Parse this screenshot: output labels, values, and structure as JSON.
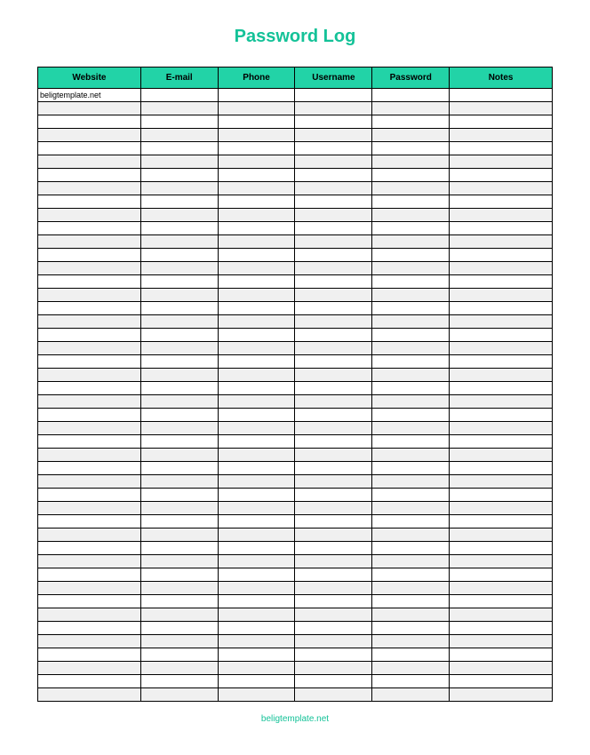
{
  "title": "Password Log",
  "footer": "beligtemplate.net",
  "colors": {
    "accent": "#14c298",
    "header_bg": "#22d3a7",
    "alt_row": "#f0f0f0"
  },
  "columns": [
    {
      "key": "website",
      "label": "Website"
    },
    {
      "key": "email",
      "label": "E-mail"
    },
    {
      "key": "phone",
      "label": "Phone"
    },
    {
      "key": "username",
      "label": "Username"
    },
    {
      "key": "password",
      "label": "Password"
    },
    {
      "key": "notes",
      "label": "Notes"
    }
  ],
  "rows": [
    {
      "website": "beligtemplate.net",
      "email": "",
      "phone": "",
      "username": "",
      "password": "",
      "notes": ""
    },
    {
      "website": "",
      "email": "",
      "phone": "",
      "username": "",
      "password": "",
      "notes": ""
    },
    {
      "website": "",
      "email": "",
      "phone": "",
      "username": "",
      "password": "",
      "notes": ""
    },
    {
      "website": "",
      "email": "",
      "phone": "",
      "username": "",
      "password": "",
      "notes": ""
    },
    {
      "website": "",
      "email": "",
      "phone": "",
      "username": "",
      "password": "",
      "notes": ""
    },
    {
      "website": "",
      "email": "",
      "phone": "",
      "username": "",
      "password": "",
      "notes": ""
    },
    {
      "website": "",
      "email": "",
      "phone": "",
      "username": "",
      "password": "",
      "notes": ""
    },
    {
      "website": "",
      "email": "",
      "phone": "",
      "username": "",
      "password": "",
      "notes": ""
    },
    {
      "website": "",
      "email": "",
      "phone": "",
      "username": "",
      "password": "",
      "notes": ""
    },
    {
      "website": "",
      "email": "",
      "phone": "",
      "username": "",
      "password": "",
      "notes": ""
    },
    {
      "website": "",
      "email": "",
      "phone": "",
      "username": "",
      "password": "",
      "notes": ""
    },
    {
      "website": "",
      "email": "",
      "phone": "",
      "username": "",
      "password": "",
      "notes": ""
    },
    {
      "website": "",
      "email": "",
      "phone": "",
      "username": "",
      "password": "",
      "notes": ""
    },
    {
      "website": "",
      "email": "",
      "phone": "",
      "username": "",
      "password": "",
      "notes": ""
    },
    {
      "website": "",
      "email": "",
      "phone": "",
      "username": "",
      "password": "",
      "notes": ""
    },
    {
      "website": "",
      "email": "",
      "phone": "",
      "username": "",
      "password": "",
      "notes": ""
    },
    {
      "website": "",
      "email": "",
      "phone": "",
      "username": "",
      "password": "",
      "notes": ""
    },
    {
      "website": "",
      "email": "",
      "phone": "",
      "username": "",
      "password": "",
      "notes": ""
    },
    {
      "website": "",
      "email": "",
      "phone": "",
      "username": "",
      "password": "",
      "notes": ""
    },
    {
      "website": "",
      "email": "",
      "phone": "",
      "username": "",
      "password": "",
      "notes": ""
    },
    {
      "website": "",
      "email": "",
      "phone": "",
      "username": "",
      "password": "",
      "notes": ""
    },
    {
      "website": "",
      "email": "",
      "phone": "",
      "username": "",
      "password": "",
      "notes": ""
    },
    {
      "website": "",
      "email": "",
      "phone": "",
      "username": "",
      "password": "",
      "notes": ""
    },
    {
      "website": "",
      "email": "",
      "phone": "",
      "username": "",
      "password": "",
      "notes": ""
    },
    {
      "website": "",
      "email": "",
      "phone": "",
      "username": "",
      "password": "",
      "notes": ""
    },
    {
      "website": "",
      "email": "",
      "phone": "",
      "username": "",
      "password": "",
      "notes": ""
    },
    {
      "website": "",
      "email": "",
      "phone": "",
      "username": "",
      "password": "",
      "notes": ""
    },
    {
      "website": "",
      "email": "",
      "phone": "",
      "username": "",
      "password": "",
      "notes": ""
    },
    {
      "website": "",
      "email": "",
      "phone": "",
      "username": "",
      "password": "",
      "notes": ""
    },
    {
      "website": "",
      "email": "",
      "phone": "",
      "username": "",
      "password": "",
      "notes": ""
    },
    {
      "website": "",
      "email": "",
      "phone": "",
      "username": "",
      "password": "",
      "notes": ""
    },
    {
      "website": "",
      "email": "",
      "phone": "",
      "username": "",
      "password": "",
      "notes": ""
    },
    {
      "website": "",
      "email": "",
      "phone": "",
      "username": "",
      "password": "",
      "notes": ""
    },
    {
      "website": "",
      "email": "",
      "phone": "",
      "username": "",
      "password": "",
      "notes": ""
    },
    {
      "website": "",
      "email": "",
      "phone": "",
      "username": "",
      "password": "",
      "notes": ""
    },
    {
      "website": "",
      "email": "",
      "phone": "",
      "username": "",
      "password": "",
      "notes": ""
    },
    {
      "website": "",
      "email": "",
      "phone": "",
      "username": "",
      "password": "",
      "notes": ""
    },
    {
      "website": "",
      "email": "",
      "phone": "",
      "username": "",
      "password": "",
      "notes": ""
    },
    {
      "website": "",
      "email": "",
      "phone": "",
      "username": "",
      "password": "",
      "notes": ""
    },
    {
      "website": "",
      "email": "",
      "phone": "",
      "username": "",
      "password": "",
      "notes": ""
    },
    {
      "website": "",
      "email": "",
      "phone": "",
      "username": "",
      "password": "",
      "notes": ""
    },
    {
      "website": "",
      "email": "",
      "phone": "",
      "username": "",
      "password": "",
      "notes": ""
    },
    {
      "website": "",
      "email": "",
      "phone": "",
      "username": "",
      "password": "",
      "notes": ""
    },
    {
      "website": "",
      "email": "",
      "phone": "",
      "username": "",
      "password": "",
      "notes": ""
    },
    {
      "website": "",
      "email": "",
      "phone": "",
      "username": "",
      "password": "",
      "notes": ""
    },
    {
      "website": "",
      "email": "",
      "phone": "",
      "username": "",
      "password": "",
      "notes": ""
    }
  ]
}
